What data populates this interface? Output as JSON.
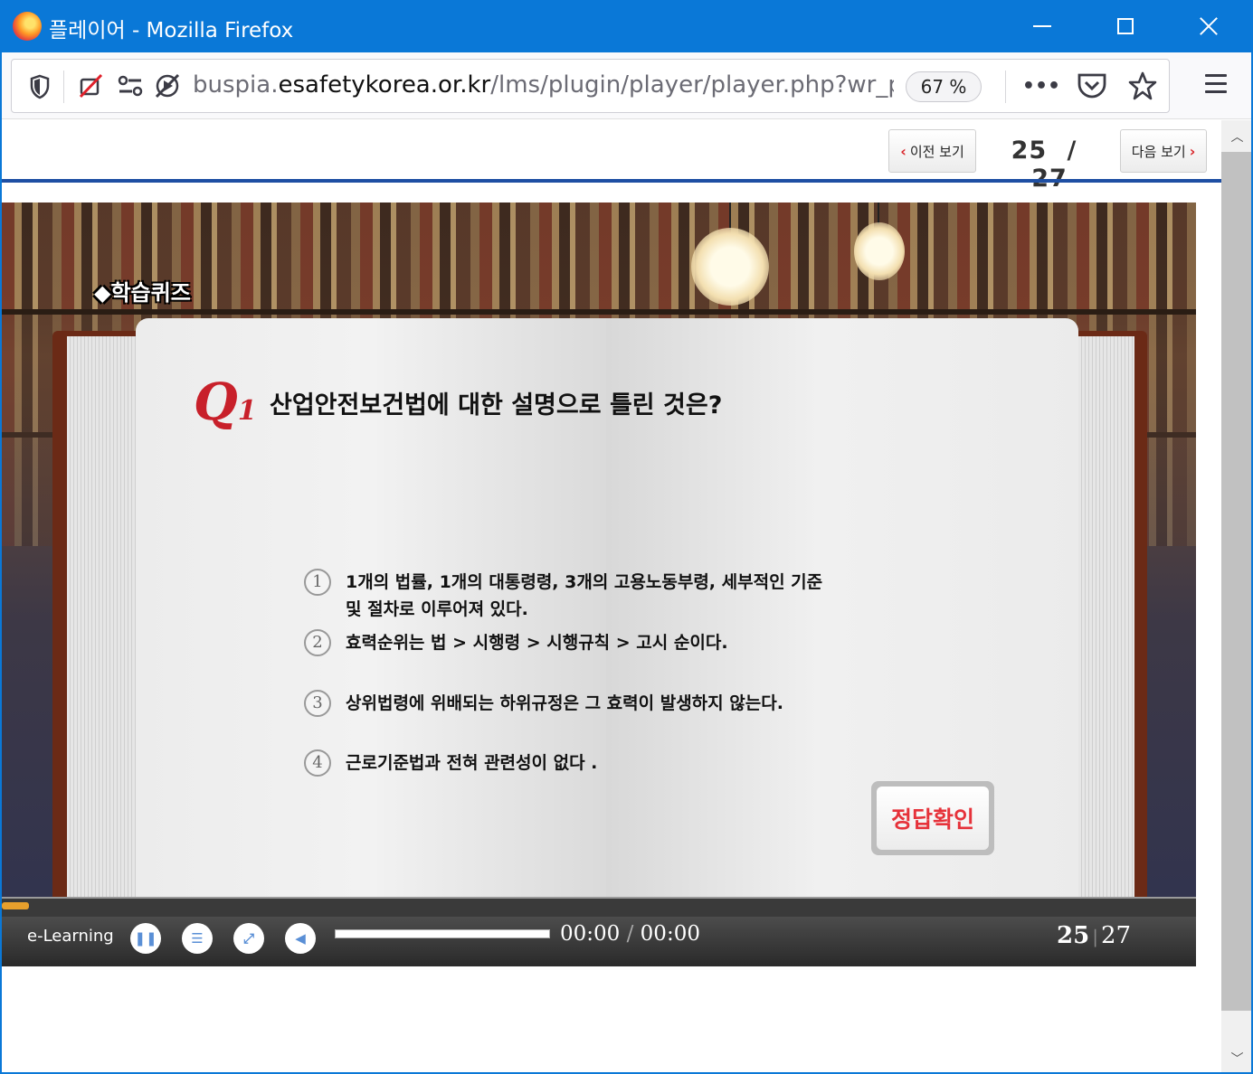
{
  "window": {
    "title": "플레이어 - Mozilla Firefox"
  },
  "toolbar": {
    "url_scheme_path_before": "buspia.",
    "url_host": "esafetykorea.or.kr",
    "url_path": "/lms/plugin/player/player.php?wr_pag",
    "zoom": "67 %",
    "more_label": "•••"
  },
  "pager": {
    "prev_label": "이전 보기",
    "next_label": "다음 보기",
    "current": "25",
    "separator": "/",
    "total": "27"
  },
  "quiz": {
    "tag": "◆학습퀴즈",
    "q_letter": "Q",
    "q_number": "1",
    "question": "산업안전보건법에 대한 설명으로 틀린 것은?",
    "options": [
      {
        "num": "1",
        "text": "1개의 법률, 1개의 대통령령, 3개의 고용노동부령, 세부적인 기준\n및 절차로 이루어져 있다."
      },
      {
        "num": "2",
        "text": "효력순위는 법 > 시행령 > 시행규칙 > 고시 순이다."
      },
      {
        "num": "3",
        "text": "상위법령에 위배되는 하위규정은 그 효력이 발생하지 않는다."
      },
      {
        "num": "4",
        "text": "근로기준법과 전혀 관련성이 없다 ."
      }
    ],
    "check_label": "정답확인"
  },
  "player": {
    "brand": "e-Learning",
    "time_current": "00:00",
    "time_sep": "/",
    "time_total": "00:00",
    "page_current": "25",
    "page_total": "27",
    "progress_fraction": 0.02
  },
  "colors": {
    "titlebar": "#0a78d7",
    "accent_red": "#c8202a",
    "rule_blue": "#1e4fa3"
  }
}
